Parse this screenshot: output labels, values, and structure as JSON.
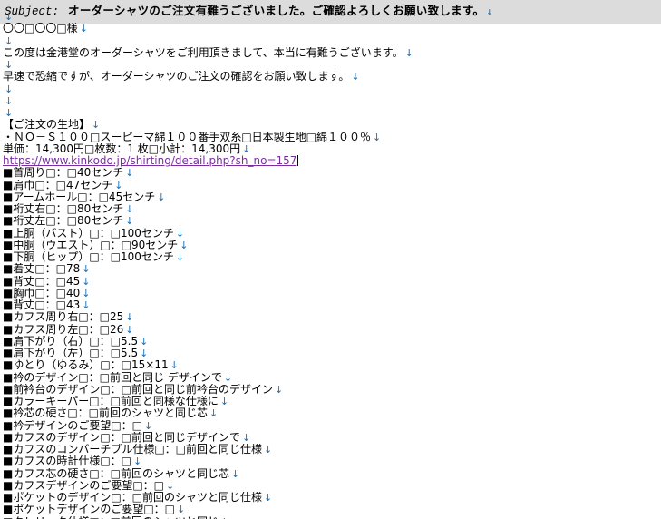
{
  "subject": {
    "label": "Subject:",
    "text": "オーダーシャツのご注文有難うございました。ご確認よろしくお願い致します。"
  },
  "newline_mark": "↓",
  "lines": [
    "",
    "〇〇□〇〇□様",
    "",
    "この度は金港堂のオーダーシャツをご利用頂きまして、本当に有難うございます。",
    "",
    "早速で恐縮ですが、オーダーシャツのご注文の確認をお願い致します。",
    "",
    "",
    "",
    "【ご注文の生地】",
    "・ＮＯ－Ｓ１００□スーピーマ綿１００番手双糸□日本製生地□綿１００％",
    "単価：14,300円□枚数：1 枚□小計：14,300円",
    "https://www.kinkodo.jp/shirting/detail.php?sh_no=157",
    "■首周り□：□40センチ",
    "■肩巾□：□47センチ",
    "■アームホール□：□45センチ",
    "■裄丈右□：□80センチ",
    "■裄丈左□：□80センチ",
    "■上胴（バスト）□：□100センチ",
    "■中胴（ウエスト）□：□90センチ",
    "■下胴（ヒップ）□：□100センチ",
    "■着丈□：□78",
    "■背丈□：□45",
    "■胸巾□：□40",
    "■背丈□：□43",
    "■カフス周り右□：□25",
    "■カフス周り左□：□26",
    "■肩下がり（右）□：□5.5",
    "■肩下がり（左）□：□5.5",
    "■ゆとり（ゆるみ）□：□15×11",
    "■衿のデザイン□：□前回と同じ デザインで",
    "■前衿台のデザイン□：□前回と同じ前衿台のデザイン",
    "■カラーキーパー□：□前回と同様な仕様に",
    "■衿芯の硬さ□：□前回のシャツと同じ芯",
    "■衿デザインのご要望□：□",
    "■カフスのデザイン□：□前回と同じデザインで",
    "■カフスのコンバーチブル仕様□：□前回と同じ仕様",
    "■カフスの時計仕様□：□",
    "■カフス芯の硬さ□：□前回のシャツと同じ芯",
    "■カフスデザインのご要望□：□",
    "■ポケットのデザイン□：□前回のシャツと同じ仕様",
    "■ポケットデザインのご要望□：□",
    "■クレリック仕様□：□前回のシャツと同じ"
  ],
  "link_line_index": 12
}
